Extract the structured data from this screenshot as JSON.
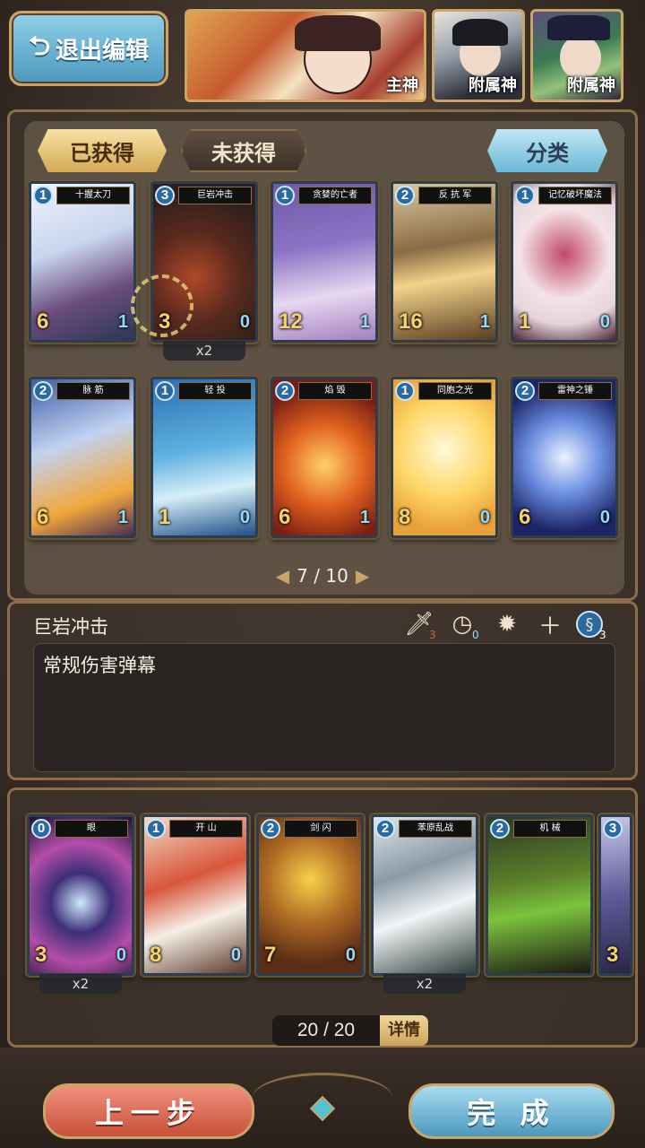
{
  "header": {
    "exit_label": "退出编辑",
    "exit_icon": "return-arrow-icon",
    "portraits": [
      {
        "tag": "主神"
      },
      {
        "tag": "附属神"
      },
      {
        "tag": "附属神"
      }
    ]
  },
  "tabs": {
    "obtained": "已获得",
    "not_obtained": "未获得",
    "sort": "分类"
  },
  "collection": {
    "cards": [
      {
        "cost": "1",
        "title": "十握太刀",
        "atk": "6",
        "def": "1"
      },
      {
        "cost": "3",
        "title": "巨岩冲击",
        "atk": "3",
        "def": "0",
        "count": "x2"
      },
      {
        "cost": "1",
        "title": "贪婪的亡者",
        "atk": "12",
        "def": "1"
      },
      {
        "cost": "2",
        "title": "反 抗 军",
        "atk": "16",
        "def": "1"
      },
      {
        "cost": "1",
        "title": "记忆破坏魔法",
        "atk": "1",
        "def": "0"
      },
      {
        "cost": "2",
        "title": "脉 筋",
        "atk": "6",
        "def": "1"
      },
      {
        "cost": "1",
        "title": "轻 投",
        "atk": "1",
        "def": "0"
      },
      {
        "cost": "2",
        "title": "焰 毁",
        "atk": "6",
        "def": "1"
      },
      {
        "cost": "1",
        "title": "同胞之光",
        "atk": "8",
        "def": "0"
      },
      {
        "cost": "2",
        "title": "雷神之锤",
        "atk": "6",
        "def": "0"
      }
    ],
    "page": "7 / 10"
  },
  "detail": {
    "name": "巨岩冲击",
    "description": "常规伤害弹幕",
    "stats": {
      "sword": "3",
      "clock": "0",
      "cost": "3"
    }
  },
  "deck": {
    "cards": [
      {
        "cost": "0",
        "title": "眼",
        "atk": "3",
        "def": "0",
        "count": "x2"
      },
      {
        "cost": "1",
        "title": "开 山",
        "atk": "8",
        "def": "0"
      },
      {
        "cost": "2",
        "title": "剑 闪",
        "atk": "7",
        "def": "0"
      },
      {
        "cost": "2",
        "title": "苯原乱战",
        "atk": "",
        "def": "",
        "count": "x2"
      },
      {
        "cost": "2",
        "title": "机 械",
        "atk": "",
        "def": ""
      },
      {
        "cost": "3",
        "title": "",
        "atk": "3",
        "def": ""
      }
    ],
    "count": "20 / 20",
    "detail_label": "详情"
  },
  "footer": {
    "prev_label": "上一步",
    "done_label": "完 成"
  },
  "colors": {
    "accent_gold": "#c9a56a",
    "btn_blue": "#4b98be",
    "btn_red": "#c8503a"
  }
}
